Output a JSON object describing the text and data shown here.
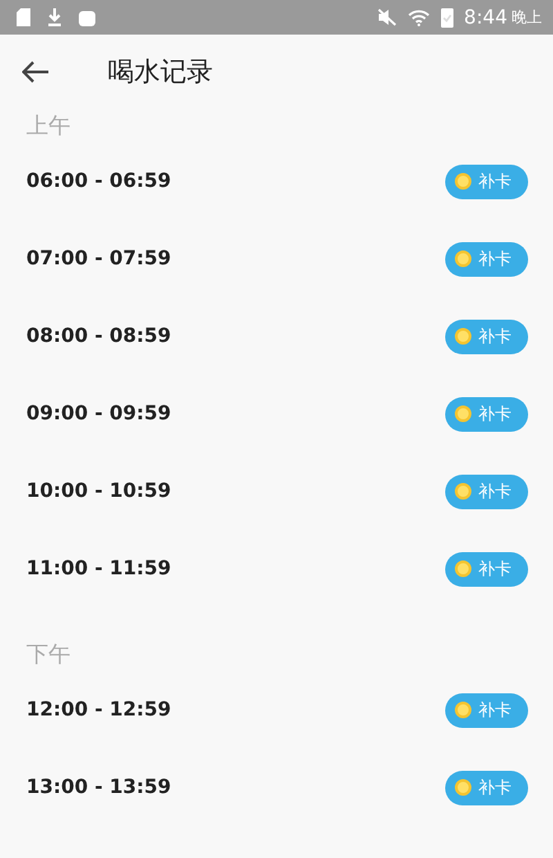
{
  "status_bar": {
    "time": "8:44",
    "period": "晚上"
  },
  "header": {
    "title": "喝水记录"
  },
  "sections": [
    {
      "label": "上午",
      "rows": [
        {
          "time": "06:00 - 06:59",
          "action": "补卡"
        },
        {
          "time": "07:00 - 07:59",
          "action": "补卡"
        },
        {
          "time": "08:00 - 08:59",
          "action": "补卡"
        },
        {
          "time": "09:00 - 09:59",
          "action": "补卡"
        },
        {
          "time": "10:00 - 10:59",
          "action": "补卡"
        },
        {
          "time": "11:00 - 11:59",
          "action": "补卡"
        }
      ]
    },
    {
      "label": "下午",
      "rows": [
        {
          "time": "12:00 - 12:59",
          "action": "补卡"
        },
        {
          "time": "13:00 - 13:59",
          "action": "补卡"
        }
      ]
    }
  ]
}
